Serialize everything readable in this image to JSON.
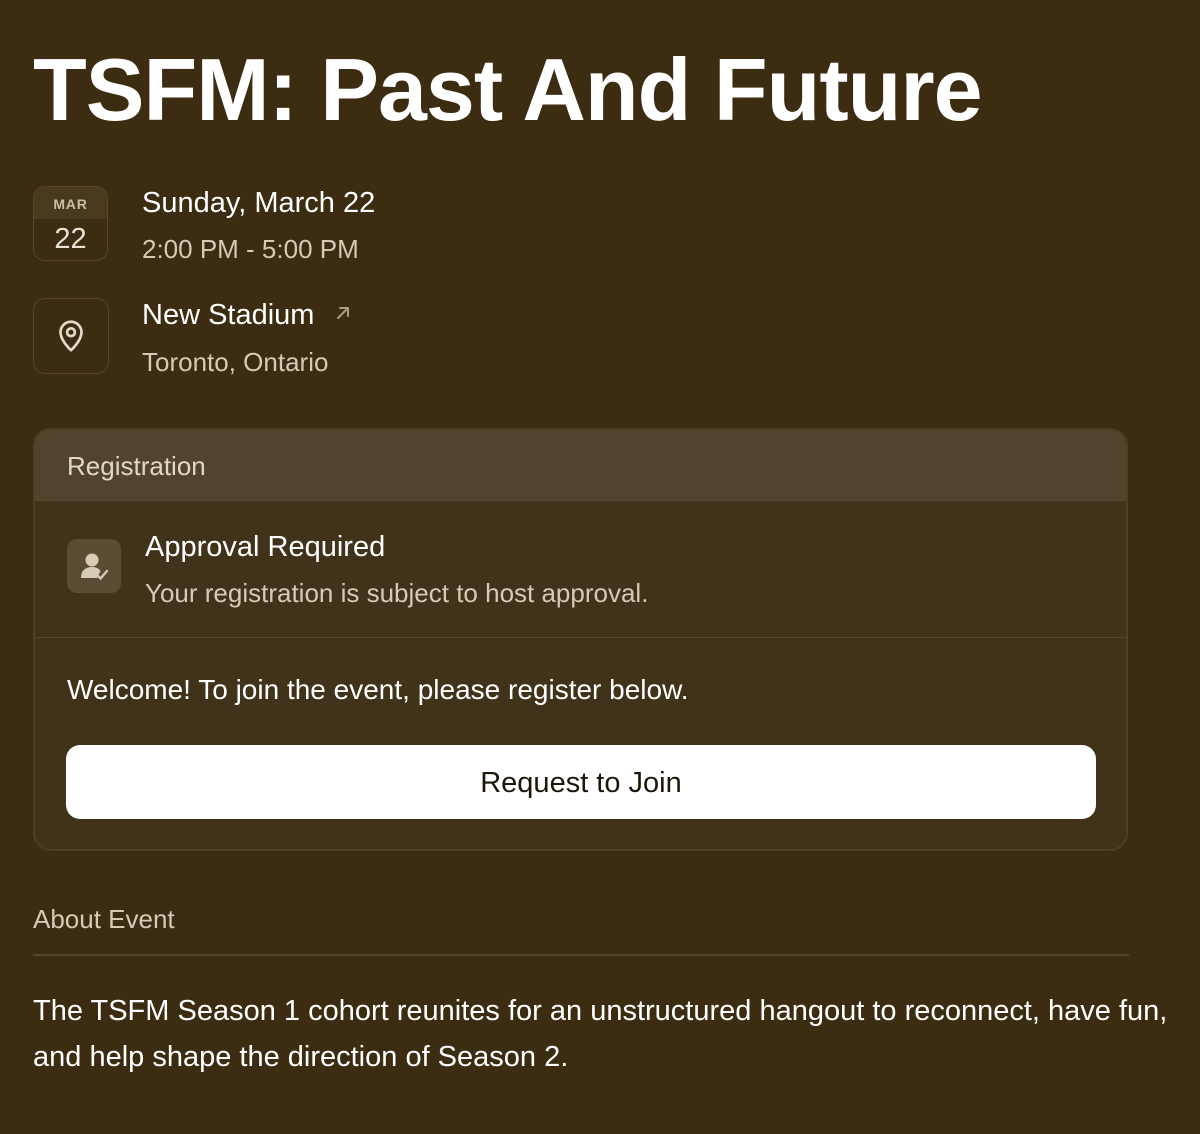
{
  "event": {
    "title": "TSFM: Past And Future"
  },
  "date": {
    "month": "MAR",
    "day": "22",
    "full": "Sunday, March 22",
    "time": "2:00 PM - 5:00 PM"
  },
  "location": {
    "venue": "New Stadium",
    "city": "Toronto, Ontario",
    "icon": "map-pin-icon",
    "link_icon": "arrow-up-right-icon"
  },
  "registration": {
    "header": "Registration",
    "approval_icon": "user-check-icon",
    "approval_title": "Approval Required",
    "approval_desc": "Your registration is subject to host approval.",
    "welcome": "Welcome! To join the event, please register below.",
    "button_label": "Request to Join"
  },
  "about": {
    "title": "About Event",
    "description": "The TSFM Season 1 cohort reunites for an unstructured hangout to reconnect, have fun, and help shape the direction of Season 2."
  },
  "colors": {
    "background": "#3b2c12",
    "card": "#41321a",
    "card_header": "#52432c",
    "button": "#ffffff",
    "muted_text": "#d4cab5"
  }
}
